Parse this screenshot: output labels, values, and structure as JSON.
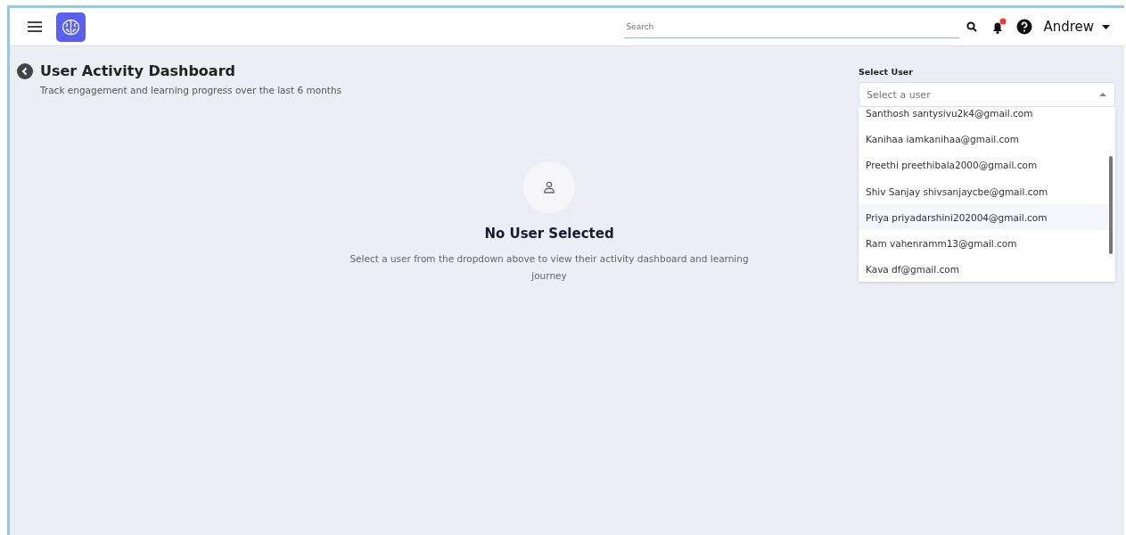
{
  "header": {
    "search": {
      "placeholder": "Search"
    },
    "notifications": {
      "unread": true
    },
    "user": {
      "name": "Andrew"
    }
  },
  "page": {
    "title": "User Activity Dashboard",
    "subtitle": "Track engagement and learning progress over the last 6 months"
  },
  "select_user": {
    "label": "Select User",
    "placeholder": "Select a user",
    "expanded": true,
    "options": [
      {
        "label": "Santhosh santysivu2k4@gmail.com",
        "highlighted": false
      },
      {
        "label": "Kanihaa iamkanihaa@gmail.com",
        "highlighted": false
      },
      {
        "label": "Preethi preethibala2000@gmail.com",
        "highlighted": false
      },
      {
        "label": "Shiv Sanjay shivsanjaycbe@gmail.com",
        "highlighted": false
      },
      {
        "label": "Priya priyadarshini202004@gmail.com",
        "highlighted": true
      },
      {
        "label": "Ram vahenramm13@gmail.com",
        "highlighted": false
      },
      {
        "label": "Kava df@gmail.com",
        "highlighted": false
      }
    ]
  },
  "empty_state": {
    "title": "No User Selected",
    "message": "Select a user from the dropdown above to view their activity dashboard and learning journey"
  }
}
